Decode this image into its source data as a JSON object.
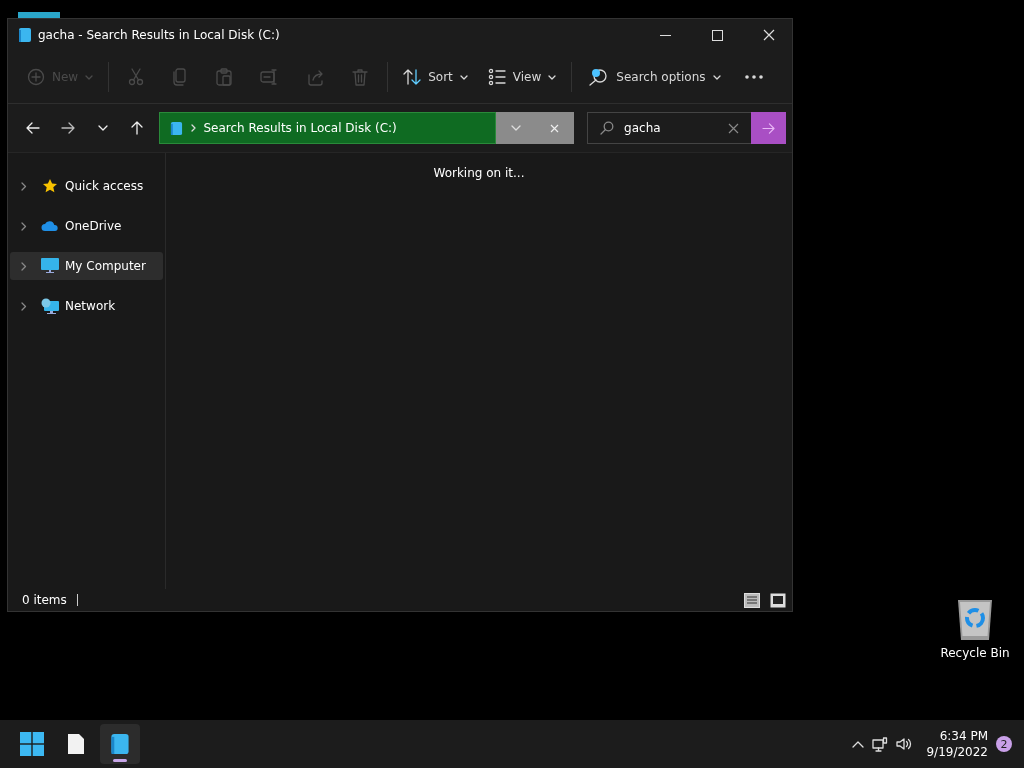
{
  "window": {
    "title": "gacha - Search Results in Local Disk (C:)"
  },
  "toolbar": [
    {
      "kind": "dropdown",
      "label": "New",
      "disabled": true
    },
    {
      "kind": "separator"
    },
    {
      "kind": "icon",
      "disabled": true
    },
    {
      "kind": "icon",
      "disabled": true
    },
    {
      "kind": "icon",
      "disabled": true
    },
    {
      "kind": "icon",
      "disabled": true
    },
    {
      "kind": "icon",
      "disabled": true
    },
    {
      "kind": "icon",
      "disabled": true
    },
    {
      "kind": "separator"
    },
    {
      "kind": "dropdown",
      "label": "Sort",
      "disabled": false
    },
    {
      "kind": "dropdown",
      "label": "View",
      "disabled": false
    },
    {
      "kind": "separator"
    },
    {
      "kind": "dropdown",
      "label": "Search options",
      "disabled": false
    },
    {
      "kind": "icon",
      "disabled": false
    }
  ],
  "address": {
    "path": "Search Results in Local Disk (C:)"
  },
  "search": {
    "value": "gacha"
  },
  "sidebar": {
    "items": [
      {
        "label": "Quick access",
        "selected": false
      },
      {
        "label": "OneDrive",
        "selected": false
      },
      {
        "label": "My Computer",
        "selected": true
      },
      {
        "label": "Network",
        "selected": false
      }
    ]
  },
  "content": {
    "message": "Working on it..."
  },
  "status_bar": {
    "count": "0 items"
  },
  "desktop": {
    "icons": [
      {
        "label": "Recycle Bin"
      }
    ]
  },
  "taskbar": {
    "apps": [
      {
        "selected": false
      },
      {
        "selected": false
      },
      {
        "selected": true
      }
    ],
    "time": "6:34 PM",
    "date": "9/19/2022",
    "notifications": "2"
  }
}
